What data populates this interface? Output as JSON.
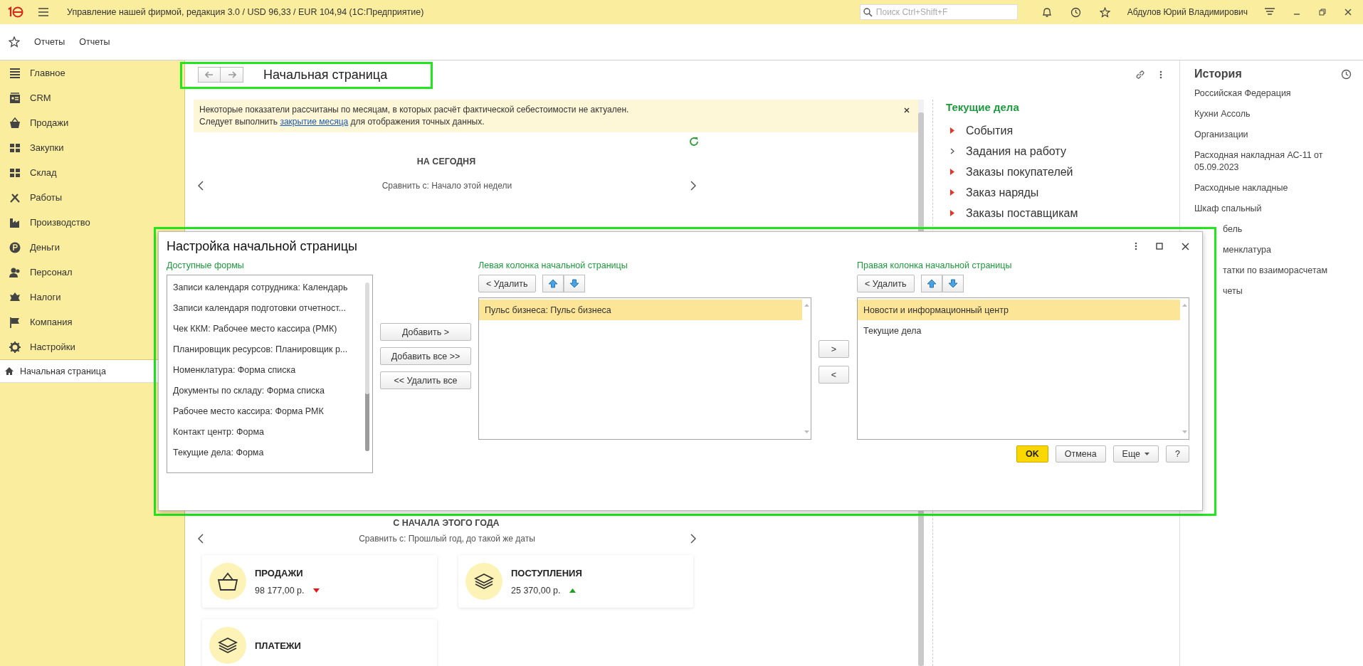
{
  "window": {
    "title": "Управление нашей фирмой, редакция 3.0 / USD 96,33 / EUR 104,94  (1С:Предприятие)",
    "search_placeholder": "Поиск Ctrl+Shift+F",
    "user": "Абдулов Юрий Владимирович"
  },
  "favorites_bar": {
    "items": [
      "Отчеты",
      "Отчеты"
    ]
  },
  "sidebar": {
    "items": [
      {
        "label": "Главное",
        "selected": false
      },
      {
        "label": "CRM",
        "selected": false
      },
      {
        "label": "Продажи",
        "selected": false
      },
      {
        "label": "Закупки",
        "selected": false
      },
      {
        "label": "Склад",
        "selected": false
      },
      {
        "label": "Работы",
        "selected": false
      },
      {
        "label": "Производство",
        "selected": false
      },
      {
        "label": "Деньги",
        "selected": false
      },
      {
        "label": "Персонал",
        "selected": false
      },
      {
        "label": "Налоги",
        "selected": false
      },
      {
        "label": "Компания",
        "selected": false
      },
      {
        "label": "Настройки",
        "selected": false
      }
    ],
    "open_pages": [
      {
        "label": "Начальная страница",
        "selected": true
      }
    ]
  },
  "page": {
    "title": "Начальная страница",
    "notice": {
      "line1": "Некоторые показатели рассчитаны по месяцам, в которых расчёт фактической себестоимости не актуален.",
      "line2_before": "Следует выполнить",
      "link": "закрытие месяца",
      "line2_after": "для отображения точных данных."
    },
    "today": {
      "heading": "НА СЕГОДНЯ",
      "compare": "Сравнить с: Начало этой недели"
    },
    "year": {
      "heading": "С НАЧАЛА ЭТОГО ГОДА",
      "compare": "Сравнить с: Прошлый год, до такой же даты",
      "cards": [
        {
          "title": "ПРОДАЖИ",
          "value": "98 177,00 р.",
          "trend_up": false
        },
        {
          "title": "ПОСТУПЛЕНИЯ",
          "value": "25 370,00 р.",
          "trend_up": true
        },
        {
          "title": "ПЛАТЕЖИ"
        }
      ]
    }
  },
  "current_tasks": {
    "title": "Текущие дела",
    "items": [
      {
        "label": "События",
        "kind": "marked"
      },
      {
        "label": "Задания на работу",
        "kind": "plain"
      },
      {
        "label": "Заказы покупателей",
        "kind": "marked"
      },
      {
        "label": "Заказ наряды",
        "kind": "marked"
      },
      {
        "label": "Заказы поставщикам",
        "kind": "marked"
      }
    ]
  },
  "history": {
    "title": "История",
    "items": [
      {
        "label": "Российская Федерация",
        "kind": "full"
      },
      {
        "label": "Кухни Ассоль",
        "kind": "full"
      },
      {
        "label": "Организации",
        "kind": "full"
      },
      {
        "label": "Расходная накладная АС-11 от 05.09.2023",
        "kind": "full"
      },
      {
        "label": "Расходные накладные",
        "kind": "full"
      },
      {
        "label": "Шкаф спальный",
        "kind": "full"
      },
      {
        "label": "бель",
        "kind": "cut"
      },
      {
        "label": "менклатура",
        "kind": "cut"
      },
      {
        "label": "татки по взаиморасчетам",
        "kind": "cut"
      },
      {
        "label": "четы",
        "kind": "cut"
      }
    ]
  },
  "dialog": {
    "title": "Настройка начальной страницы",
    "available": {
      "label": "Доступные формы",
      "items": [
        {
          "label": "Записи календаря сотрудника: Календарь",
          "selected": false
        },
        {
          "label": "Записи календаря подготовки отчетност...",
          "selected": false
        },
        {
          "label": "Чек ККМ: Рабочее место кассира (РМК)",
          "selected": false
        },
        {
          "label": "Планировщик ресурсов: Планировщик р...",
          "selected": false
        },
        {
          "label": "Номенклатура: Форма списка",
          "selected": false
        },
        {
          "label": "Документы по складу: Форма списка",
          "selected": false
        },
        {
          "label": "Рабочее место кассира: Форма РМК",
          "selected": false
        },
        {
          "label": "Контакт центр: Форма",
          "selected": false
        },
        {
          "label": "Текущие дела: Форма",
          "selected": false
        }
      ]
    },
    "transfer_buttons": [
      "Добавить >",
      "Добавить все >>",
      "<< Удалить все"
    ],
    "left_column": {
      "label": "Левая колонка начальной страницы",
      "remove_button": "< Удалить",
      "items": [
        {
          "label": "Пульс бизнеса: Пульс бизнеса",
          "selected": true
        }
      ]
    },
    "move_buttons": [
      ">",
      "<"
    ],
    "right_column": {
      "label": "Правая колонка начальной страницы",
      "remove_button": "< Удалить",
      "items": [
        {
          "label": "Новости и информационный центр",
          "selected": true
        },
        {
          "label": "Текущие дела",
          "selected": false
        }
      ]
    },
    "footer_buttons": [
      {
        "label": "OK",
        "kind": "primary"
      },
      {
        "label": "Отмена",
        "kind": "normal"
      },
      {
        "label": "Еще",
        "kind": "dropdown"
      },
      {
        "label": "?",
        "kind": "normal"
      }
    ]
  }
}
